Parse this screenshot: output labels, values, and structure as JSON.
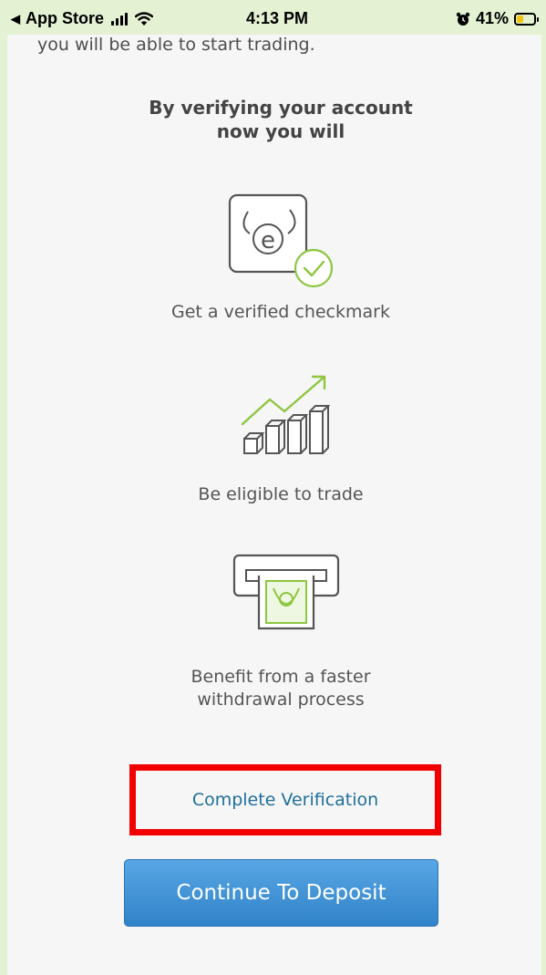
{
  "status_bar": {
    "back_label": "App Store",
    "time": "4:13 PM",
    "battery_percent": "41%",
    "battery_level": 0.41,
    "battery_color": "#f1c40f"
  },
  "content": {
    "intro_text": "you will be able to start trading.",
    "heading_line1": "By verifying your account",
    "heading_line2": "now you will",
    "features": [
      {
        "icon": "verified-badge-icon",
        "label_lines": [
          "Get a verified checkmark"
        ]
      },
      {
        "icon": "growth-chart-icon",
        "label_lines": [
          "Be eligible to trade"
        ]
      },
      {
        "icon": "cash-withdrawal-icon",
        "label_lines": [
          "Benefit from a faster",
          "withdrawal process"
        ]
      }
    ]
  },
  "actions": {
    "complete_verification": "Complete Verification",
    "continue_to_deposit": "Continue To Deposit"
  },
  "colors": {
    "accent_green": "#8dc63f",
    "link_blue": "#1f6f9b",
    "button_blue": "#3f92d8",
    "highlight_red": "#f20000"
  }
}
